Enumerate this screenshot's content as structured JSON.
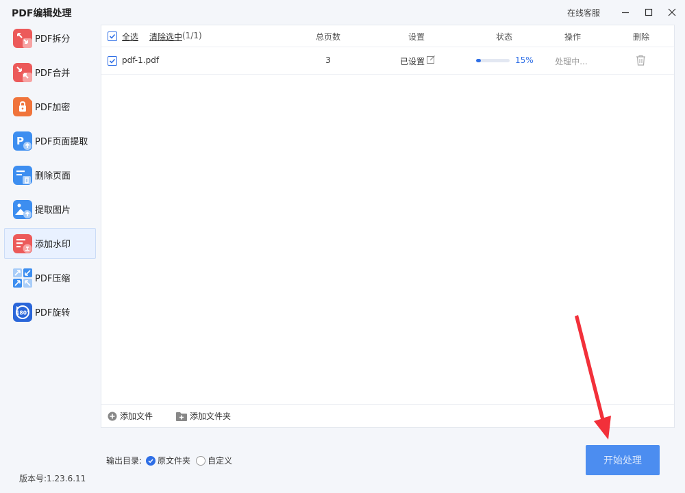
{
  "app": {
    "title": "PDF编辑处理",
    "support_link": "在线客服",
    "version": "版本号:1.23.6.11"
  },
  "sidebar": {
    "items": [
      {
        "label": "PDF拆分",
        "icon": "split-icon",
        "color": "#ec5a5a"
      },
      {
        "label": "PDF合并",
        "icon": "merge-icon",
        "color": "#ec5a5a"
      },
      {
        "label": "PDF加密",
        "icon": "lock-icon",
        "color": "#f0743b"
      },
      {
        "label": "PDF页面提取",
        "icon": "page-extract-icon",
        "color": "#3d8ef0"
      },
      {
        "label": "删除页面",
        "icon": "delete-page-icon",
        "color": "#3d8ef0"
      },
      {
        "label": "提取图片",
        "icon": "image-extract-icon",
        "color": "#3d8ef0"
      },
      {
        "label": "添加水印",
        "icon": "watermark-icon",
        "color": "#ec5a5a",
        "active": true
      },
      {
        "label": "PDF压缩",
        "icon": "compress-icon",
        "color": "#3d8ef0"
      },
      {
        "label": "PDF旋转",
        "icon": "rotate-icon",
        "color": "#2a66d9"
      }
    ]
  },
  "table": {
    "select_all": "全选",
    "clear_selected": "清除选中",
    "selected_count": "(1/1)",
    "columns": {
      "pages": "总页数",
      "settings": "设置",
      "status": "状态",
      "action": "操作",
      "delete": "删除"
    },
    "rows": [
      {
        "name": "pdf-1.pdf",
        "pages": "3",
        "settings": "已设置",
        "progress_percent": 15,
        "progress_text": "15%",
        "action": "处理中..."
      }
    ]
  },
  "footer": {
    "add_file": "添加文件",
    "add_folder": "添加文件夹"
  },
  "output": {
    "label": "输出目录:",
    "option_original": "原文件夹",
    "option_custom": "自定义",
    "selected": "原文件夹"
  },
  "start_button": "开始处理",
  "colors": {
    "accent": "#2f6fe6",
    "button": "#4c8df0",
    "arrow": "#f2303a"
  }
}
